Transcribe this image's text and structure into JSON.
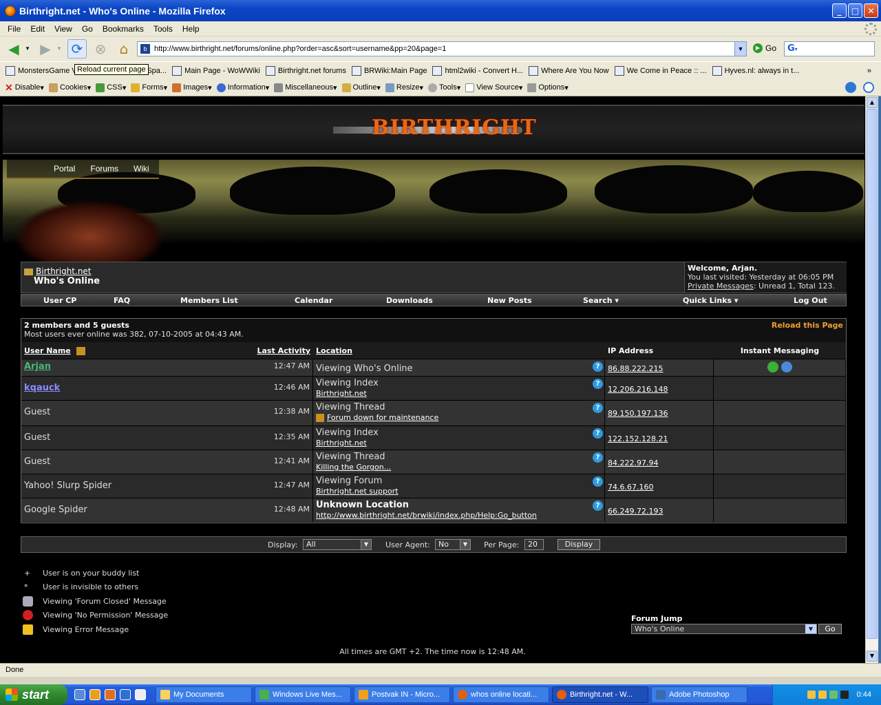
{
  "window": {
    "title": "Birthright.net - Who's Online - Mozilla Firefox"
  },
  "menu": [
    "File",
    "Edit",
    "View",
    "Go",
    "Bookmarks",
    "Tools",
    "Help"
  ],
  "nav": {
    "url": "http://www.birthright.net/forums/online.php?order=asc&sort=username&pp=20&page=1",
    "go_label": "Go",
    "tooltip": "Reload current page"
  },
  "bookmarks": [
    "MonstersGame V",
    "English-Spa...",
    "Main Page - WoWWiki",
    "Birthright.net forums",
    "BRWiki:Main Page",
    "html2wiki - Convert H...",
    "Where Are You Now",
    "We Come in Peace :: ...",
    "Hyves.nl: always in t..."
  ],
  "devbar": [
    "Disable",
    "Cookies",
    "CSS",
    "Forms",
    "Images",
    "Information",
    "Miscellaneous",
    "Outline",
    "Resize",
    "Tools",
    "View Source",
    "Options"
  ],
  "site": {
    "logo": "BIRTHRIGHT",
    "portal_nav": [
      "Portal",
      "Forums",
      "Wiki"
    ]
  },
  "breadcrumb": {
    "root": "Birthright.net",
    "current": "Who's Online"
  },
  "welcome": {
    "greeting": "Welcome, Arjan.",
    "last_visited": "You last visited: Yesterday at 06:05 PM",
    "pm_link": "Private Messages",
    "pm_rest": ": Unread 1, Total 123."
  },
  "tabs": [
    "User CP",
    "FAQ",
    "Members List",
    "Calendar",
    "Downloads",
    "New Posts",
    "Search ▾",
    "Quick Links ▾",
    "Log Out"
  ],
  "online": {
    "summary": "2 members and 5 guests",
    "record": "Most users ever online was 382, 07-10-2005 at 04:43 AM.",
    "reload": "Reload this Page",
    "headers": {
      "user": "User Name",
      "last_activity": "Last Activity",
      "location": "Location",
      "ip": "IP Address",
      "im": "Instant Messaging"
    },
    "rows": [
      {
        "user": "Arjan",
        "time": "12:47 AM",
        "loc": "Viewing Who's Online",
        "link": "",
        "ip": "86.88.222.215"
      },
      {
        "user": "kqauck",
        "time": "12:46 AM",
        "loc": "Viewing Index",
        "link": "Birthright.net",
        "ip": "12.206.216.148"
      },
      {
        "user": "Guest",
        "time": "12:38 AM",
        "loc": "Viewing Thread",
        "link": "Forum down for maintenance",
        "ip": "89.150.197.136"
      },
      {
        "user": "Guest",
        "time": "12:35 AM",
        "loc": "Viewing Index",
        "link": "Birthright.net",
        "ip": "122.152.128.21"
      },
      {
        "user": "Guest",
        "time": "12:41 AM",
        "loc": "Viewing Thread",
        "link": "Killing the Gorgon...",
        "ip": "84.222.97.94"
      },
      {
        "user": "Yahoo! Slurp Spider",
        "time": "12:47 AM",
        "loc": "Viewing Forum",
        "link": "Birthright.net support",
        "ip": "74.6.67.160"
      },
      {
        "user": "Google Spider",
        "time": "12:48 AM",
        "loc": "Unknown Location",
        "link": "http://www.birthright.net/brwiki/index.php/Help:Go_button",
        "ip": "66.249.72.193"
      }
    ]
  },
  "display_bar": {
    "display_label": "Display:",
    "display_value": "All",
    "agent_label": "User Agent:",
    "agent_value": "No",
    "perpage_label": "Per Page:",
    "perpage_value": "20",
    "button": "Display"
  },
  "legend": [
    {
      "sym": "+",
      "text": "User is on your buddy list"
    },
    {
      "sym": "*",
      "text": "User is invisible to others"
    },
    {
      "sym": "lock",
      "text": "Viewing 'Forum Closed' Message"
    },
    {
      "sym": "stop",
      "text": "Viewing 'No Permission' Message"
    },
    {
      "sym": "warn",
      "text": "Viewing Error Message"
    }
  ],
  "forum_jump": {
    "label": "Forum Jump",
    "value": "Who's Online",
    "go": "Go"
  },
  "footer_time": "All times are GMT +2. The time now is 12:48 AM.",
  "status": "Done",
  "taskbar": {
    "start": "start",
    "tasks": [
      "My Documents",
      "Windows Live Mes...",
      "Postvak IN - Micro...",
      "whos online locati...",
      "Birthright.net - W...",
      "Adobe Photoshop"
    ],
    "clock": "0:44"
  }
}
